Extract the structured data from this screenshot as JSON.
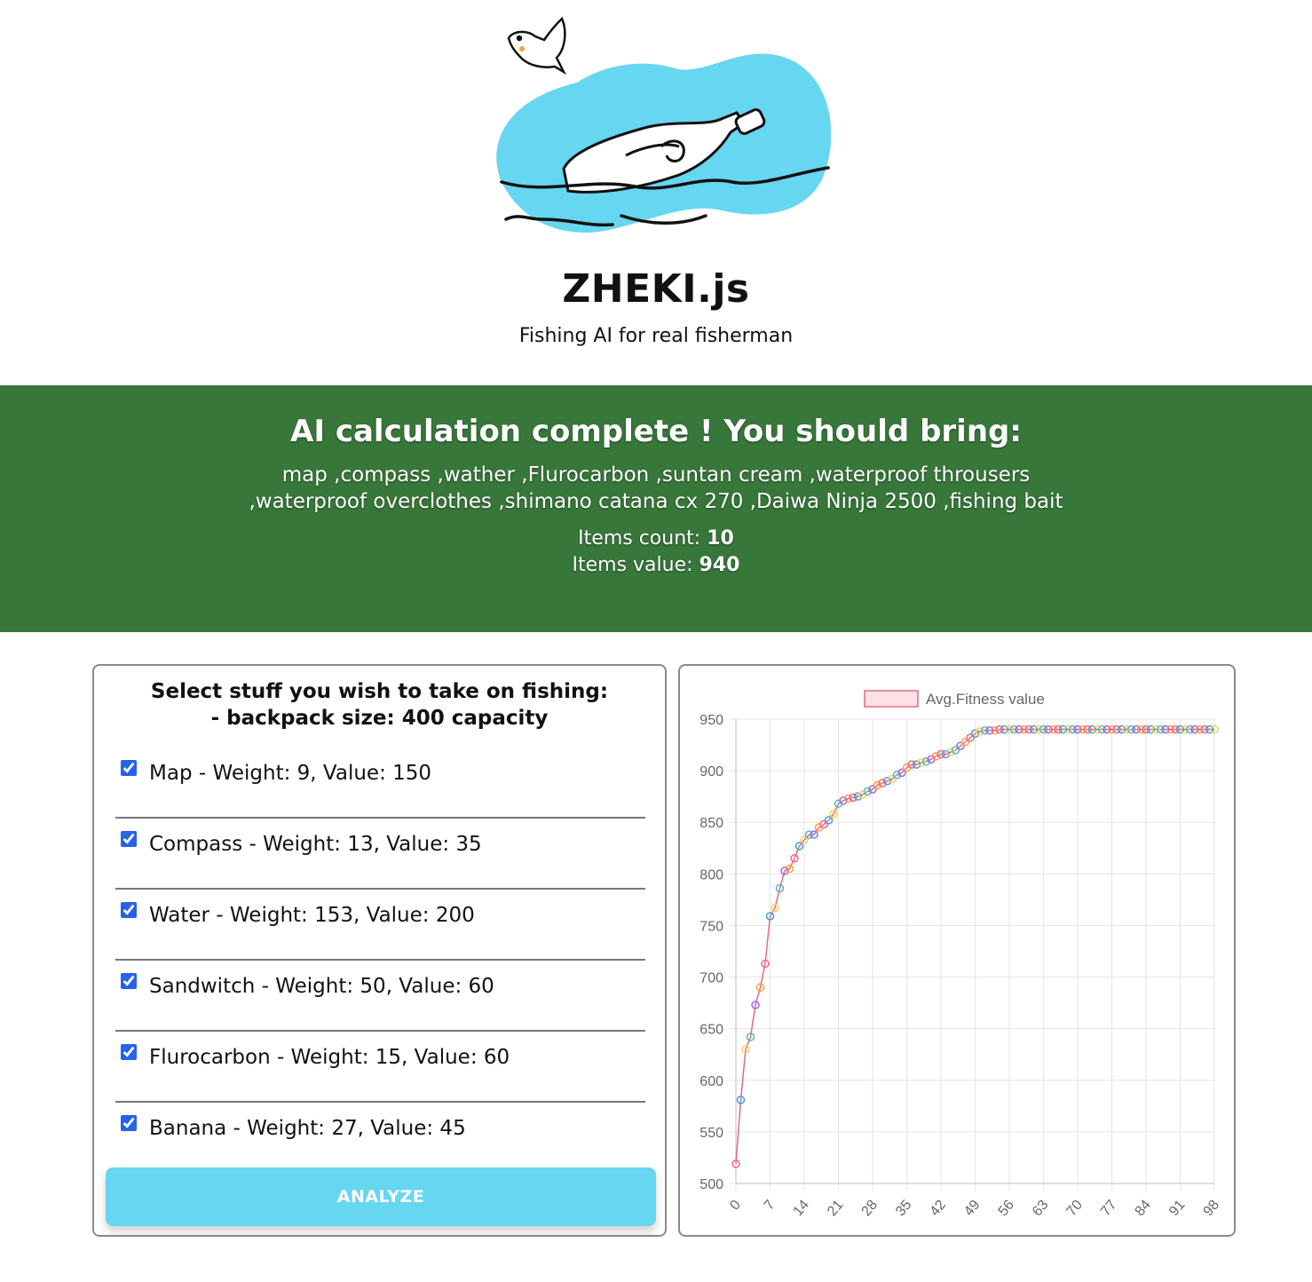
{
  "header": {
    "title": "ZHEKI.js",
    "subtitle": "Fishing AI for real fisherman",
    "logo_icon": "bottle-in-sea-with-bird-logo",
    "logo_color": "#67d6f0"
  },
  "result": {
    "title": "AI calculation complete ! You should bring:",
    "items_text": "map ,compass ,wather ,Flurocarbon ,suntan cream ,waterproof throusers ,waterproof overclothes ,shimano catana cx 270 ,Daiwa Ninja 2500 ,fishing bait",
    "count_label": "Items count:",
    "count_value": "10",
    "value_label": "Items value:",
    "value_value": "940",
    "background": "#38773a"
  },
  "selector": {
    "title_line1": "Select stuff you wish to take on fishing:",
    "title_line2": "- backpack size: 400 capacity",
    "items": [
      {
        "label": "Map - Weight: 9, Value: 150",
        "checked": true
      },
      {
        "label": "Compass - Weight: 13, Value: 35",
        "checked": true
      },
      {
        "label": "Water - Weight: 153, Value: 200",
        "checked": true
      },
      {
        "label": "Sandwitch - Weight: 50, Value: 60",
        "checked": true
      },
      {
        "label": "Flurocarbon - Weight: 15, Value: 60",
        "checked": true
      },
      {
        "label": "Banana - Weight: 27, Value: 45",
        "checked": true
      }
    ],
    "analyze_label": "ANALYZE",
    "analyze_color": "#67d6f0"
  },
  "chart_data": {
    "type": "line",
    "legend": "Avg.Fitness value",
    "legend_position": "top",
    "grid": true,
    "ylim": [
      500,
      950
    ],
    "yticks": [
      500,
      550,
      600,
      650,
      700,
      750,
      800,
      850,
      900,
      950
    ],
    "xticks": [
      0,
      7,
      14,
      21,
      28,
      35,
      42,
      49,
      56,
      63,
      70,
      77,
      84,
      91,
      98
    ],
    "line_color": "#e46a81",
    "point_colors": [
      "#ff6384",
      "#36a2eb",
      "#ffcd56",
      "#4bc0c0",
      "#9966ff",
      "#ff9f40"
    ],
    "x": [
      0,
      1,
      2,
      3,
      4,
      5,
      6,
      7,
      8,
      9,
      10,
      11,
      12,
      13,
      14,
      15,
      16,
      17,
      18,
      19,
      20,
      21,
      22,
      23,
      24,
      25,
      26,
      27,
      28,
      29,
      30,
      31,
      32,
      33,
      34,
      35,
      36,
      37,
      38,
      39,
      40,
      41,
      42,
      43,
      44,
      45,
      46,
      47,
      48,
      49,
      50,
      51,
      52,
      53,
      54,
      55,
      56,
      57,
      58,
      59,
      60,
      61,
      62,
      63,
      64,
      65,
      66,
      67,
      68,
      69,
      70,
      71,
      72,
      73,
      74,
      75,
      76,
      77,
      78,
      79,
      80,
      81,
      82,
      83,
      84,
      85,
      86,
      87,
      88,
      89,
      90,
      91,
      92,
      93,
      94,
      95,
      96,
      97,
      98
    ],
    "y": [
      519,
      581,
      630,
      642,
      673,
      690,
      713,
      759,
      767,
      786,
      803,
      805,
      815,
      827,
      833,
      838,
      838,
      845,
      848,
      852,
      858,
      868,
      871,
      873,
      874,
      875,
      877,
      880,
      882,
      886,
      888,
      890,
      892,
      896,
      898,
      903,
      906,
      906,
      908,
      909,
      911,
      914,
      916,
      916,
      918,
      920,
      924,
      928,
      932,
      936,
      938,
      939,
      939,
      939,
      940,
      940,
      940,
      940,
      940,
      940,
      940,
      940,
      940,
      940,
      940,
      940,
      940,
      940,
      940,
      940,
      940,
      940,
      940,
      940,
      940,
      940,
      940,
      940,
      940,
      940,
      940,
      940,
      940,
      940,
      940,
      940,
      940,
      940,
      940,
      940,
      940,
      940,
      940,
      940,
      940,
      940,
      940,
      940,
      940
    ]
  }
}
